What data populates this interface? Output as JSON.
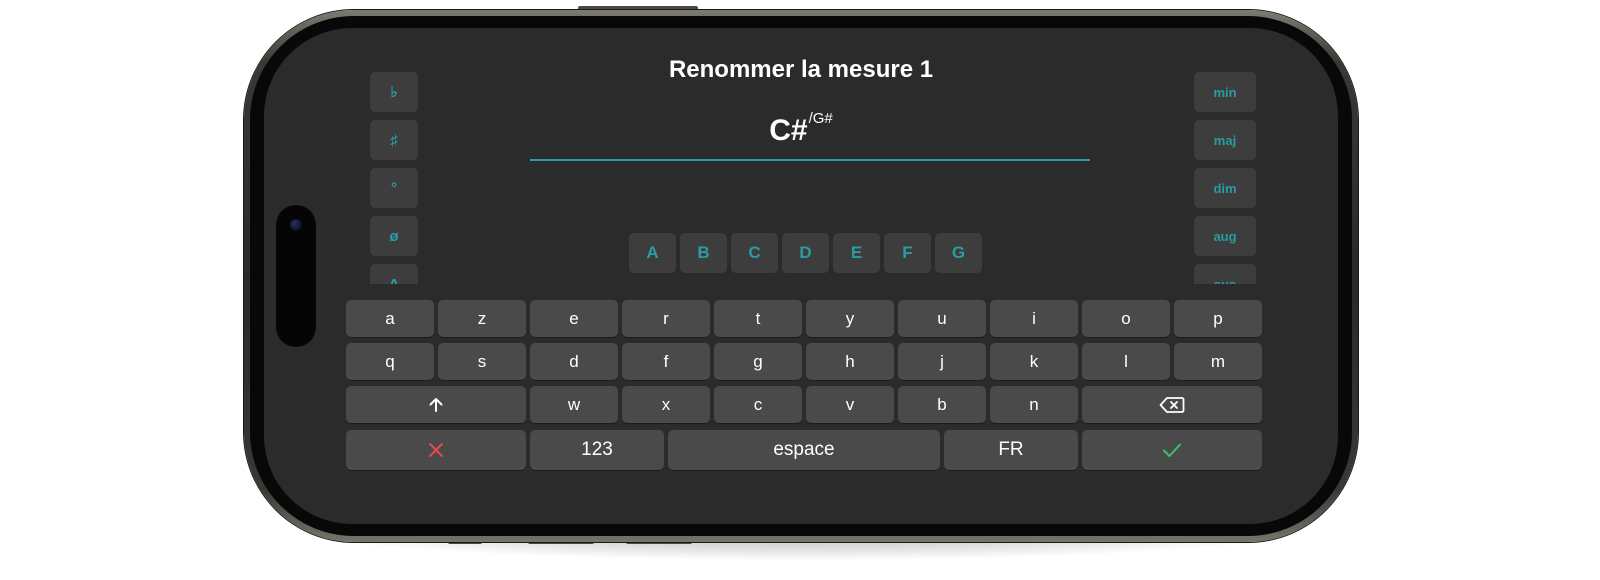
{
  "dialog": {
    "title": "Renommer la mesure 1",
    "chord_root": "C#",
    "chord_bass": "/G#"
  },
  "accent_color": "#2a9ca3",
  "modifiers_left": [
    "♭",
    "♯",
    "°",
    "ø",
    "Δ"
  ],
  "modifiers_right": [
    "min",
    "maj",
    "dim",
    "aug",
    "sus"
  ],
  "notes": [
    "A",
    "B",
    "C",
    "D",
    "E",
    "F",
    "G"
  ],
  "keyboard": {
    "row1": [
      "a",
      "z",
      "e",
      "r",
      "t",
      "y",
      "u",
      "i",
      "o",
      "p"
    ],
    "row2": [
      "q",
      "s",
      "d",
      "f",
      "g",
      "h",
      "j",
      "k",
      "l",
      "m"
    ],
    "row3": [
      "w",
      "x",
      "c",
      "v",
      "b",
      "n"
    ],
    "numbers_label": "123",
    "space_label": "espace",
    "language_label": "FR",
    "icons": {
      "shift": "arrow-up-icon",
      "backspace": "delete-left-icon",
      "cancel": "close-icon",
      "confirm": "checkmark-icon"
    },
    "cancel_color": "#e5484d",
    "confirm_color": "#35c46b"
  }
}
